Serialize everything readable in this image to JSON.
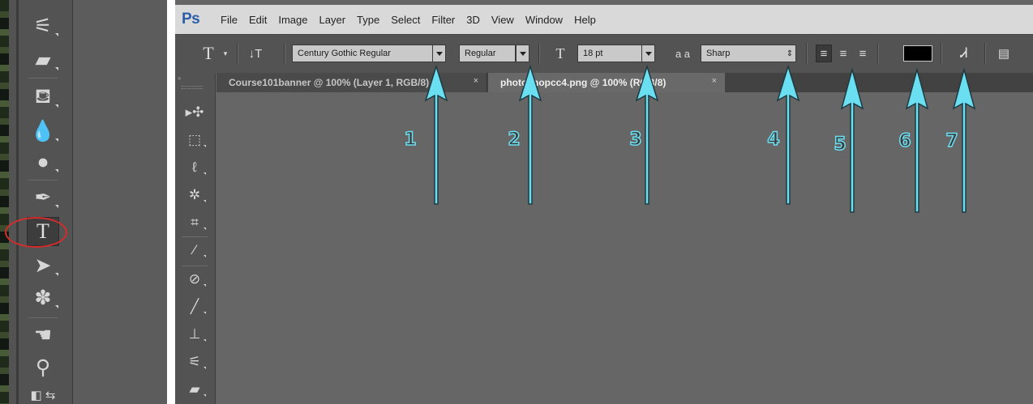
{
  "app": {
    "logo": "Ps",
    "menu": [
      "File",
      "Edit",
      "Image",
      "Layer",
      "Type",
      "Select",
      "Filter",
      "3D",
      "View",
      "Window",
      "Help"
    ]
  },
  "options_bar": {
    "tool_glyph": "T",
    "font_family": "Century Gothic Regular",
    "font_style": "Regular",
    "font_size": "18 pt",
    "aa_glyph": "a a",
    "anti_alias": "Sharp",
    "text_color": "#000000"
  },
  "tabs": [
    {
      "label": "Course101banner @ 100% (Layer 1, RGB/8)",
      "close": "×",
      "active": false
    },
    {
      "label": "photoshopcc4.png @ 100% (RGB/8)",
      "close": "×",
      "active": true
    }
  ],
  "old_toolbox": {
    "highlight_color": "#d62b2b",
    "tools": [
      "healing-brush",
      "eraser",
      "paint-bucket",
      "blur",
      "dodge",
      "pen",
      "type",
      "path-selection",
      "custom-shape",
      "hand",
      "zoom",
      "default-colors"
    ]
  },
  "tool_panel": {
    "tools": [
      "move",
      "marquee",
      "lasso",
      "quick-selection",
      "crop",
      "eyedropper",
      "spot-healing",
      "brush",
      "clone-stamp",
      "history-brush",
      "eraser"
    ]
  },
  "annotations": {
    "arrow_color": "#6bdff2",
    "labels": [
      "1",
      "2",
      "3",
      "4",
      "5",
      "6",
      "7"
    ]
  }
}
